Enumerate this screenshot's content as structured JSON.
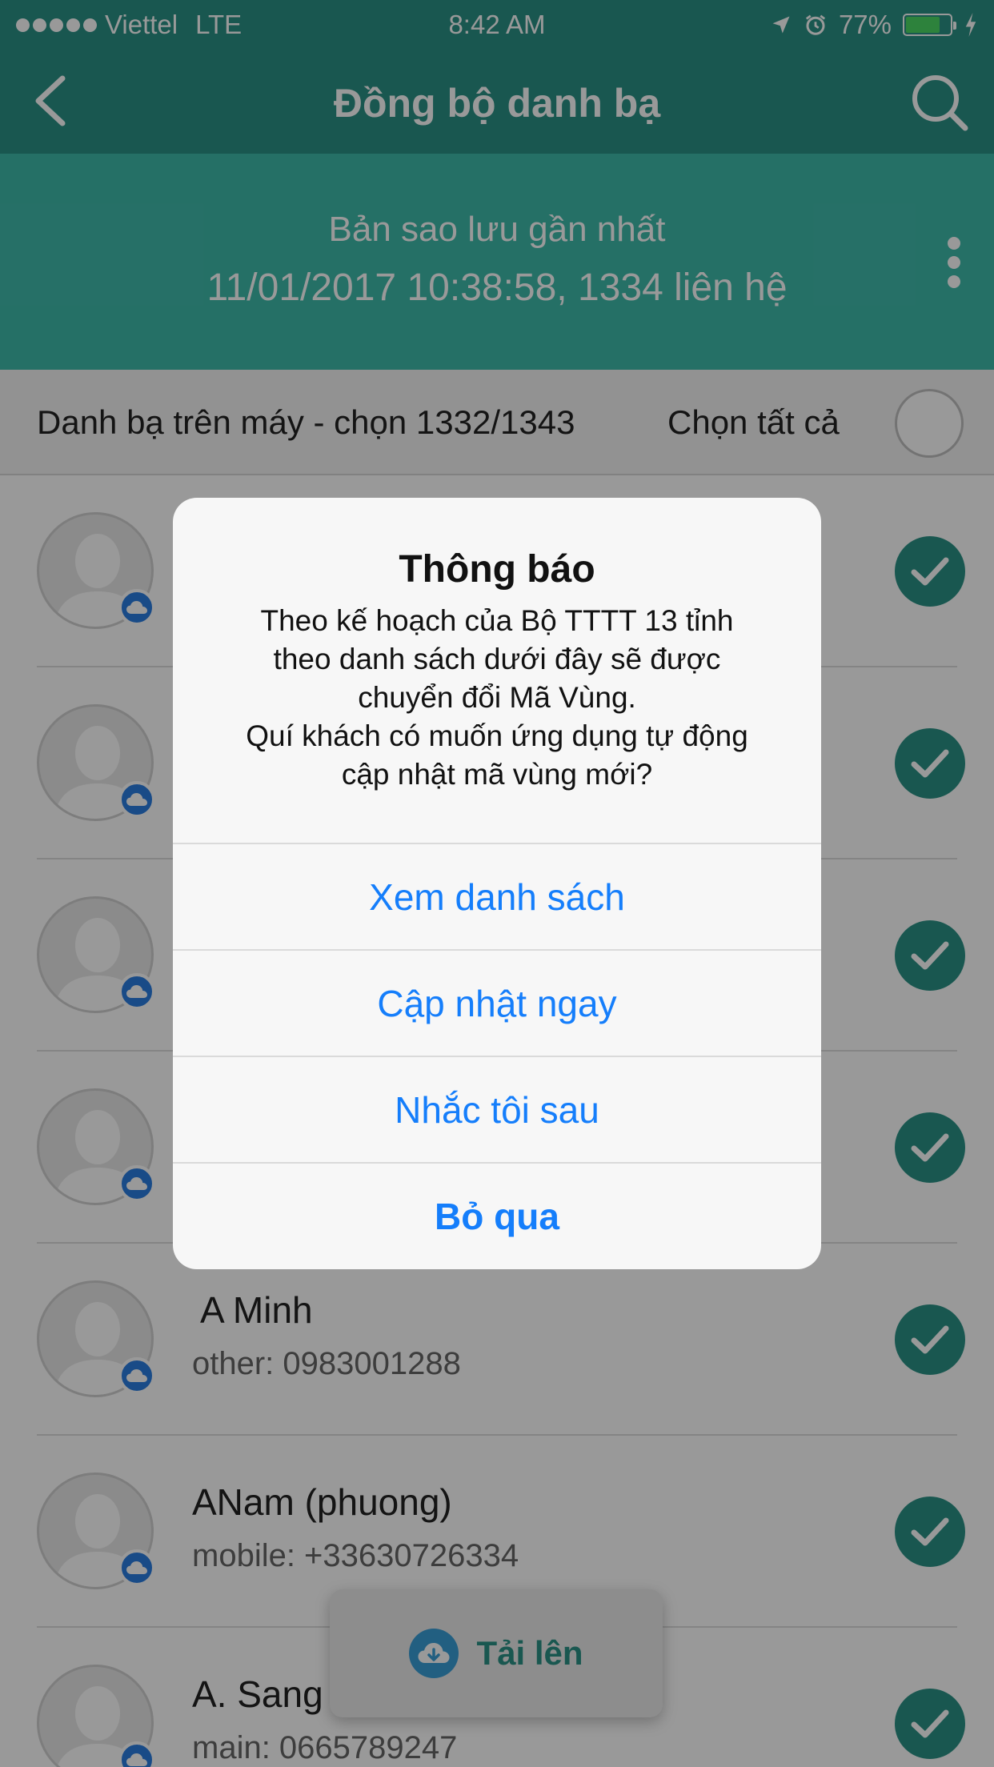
{
  "status_bar": {
    "carrier": "Viettel",
    "network": "LTE",
    "time": "8:42 AM",
    "battery": "77%",
    "battery_level": 0.77
  },
  "nav": {
    "title": "Đồng bộ danh bạ",
    "back_icon": "chevron-left-icon",
    "search_icon": "search-icon"
  },
  "backup": {
    "title": "Bản sao lưu gần nhất",
    "info": "11/01/2017 10:38:58, 1334 liên hệ",
    "more_icon": "more-vertical-icon"
  },
  "section": {
    "title": "Danh bạ trên máy - chọn 1332/1343",
    "select_all": "Chọn tất cả",
    "select_all_checked": false
  },
  "contacts": [
    {
      "name": "",
      "phone": "",
      "checked": true
    },
    {
      "name": "",
      "phone": "",
      "checked": true
    },
    {
      "name": "",
      "phone": "",
      "checked": true
    },
    {
      "name": "",
      "phone": "",
      "checked": true
    },
    {
      "name": "A Minh",
      "phone": "other: 0983001288",
      "checked": true
    },
    {
      "name": "ANam (phuong)",
      "phone": "mobile: +33630726334",
      "checked": true
    },
    {
      "name": "A. Sang",
      "phone": "main: 0665789247",
      "checked": true
    }
  ],
  "upload": {
    "label": "Tải lên",
    "icon": "cloud-download-icon"
  },
  "dialog": {
    "title": "Thông báo",
    "message_lines": [
      "Theo kế hoạch của Bộ TTTT 13 tỉnh",
      "theo danh sách dưới đây sẽ được",
      "chuyển đổi Mã Vùng.",
      "Quí khách có muốn ứng dụng tự động",
      "cập nhật mã vùng mới?"
    ],
    "buttons": [
      {
        "label": "Xem danh sách",
        "bold": false
      },
      {
        "label": "Cập nhật ngay",
        "bold": false
      },
      {
        "label": "Nhắc tôi sau",
        "bold": false
      },
      {
        "label": "Bỏ qua",
        "bold": true
      }
    ]
  },
  "colors": {
    "primary": "#2a9286",
    "panel": "#3fbbab",
    "badge": "#2a7de1",
    "dialog_button": "#157efb"
  }
}
